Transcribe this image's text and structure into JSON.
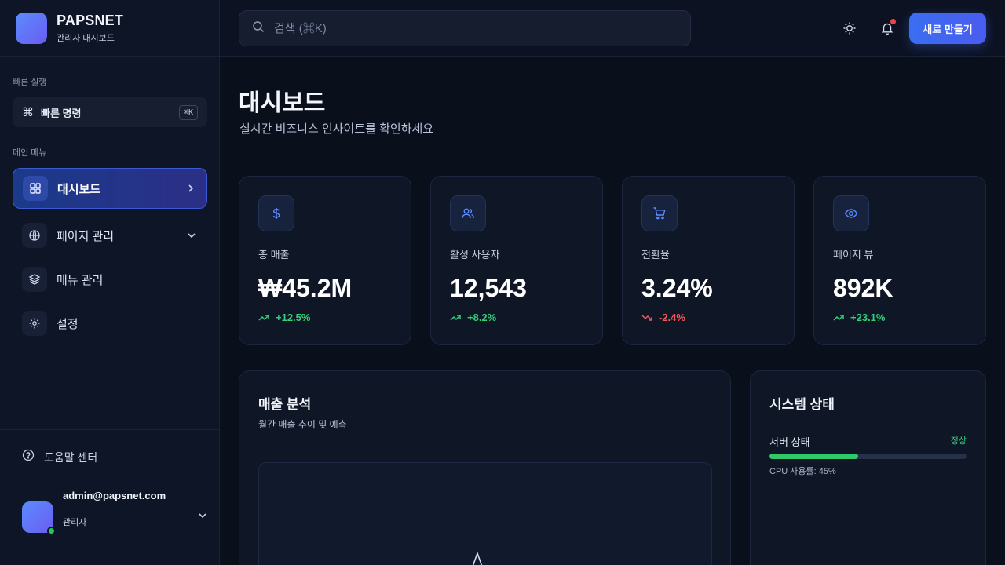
{
  "brand": {
    "name": "PAPSNET",
    "subtitle": "관리자 대시보드"
  },
  "sidebar": {
    "quick_section": "빠른 실행",
    "quick_command": {
      "label": "빠른 명령",
      "shortcut": "⌘K",
      "icon": "command-icon"
    },
    "main_section": "메인 메뉴",
    "items": [
      {
        "label": "대시보드",
        "icon": "grid-icon",
        "active": true
      },
      {
        "label": "페이지 관리",
        "icon": "globe-icon"
      },
      {
        "label": "메뉴 관리",
        "icon": "layers-icon"
      },
      {
        "label": "설정",
        "icon": "gear-icon"
      }
    ],
    "help": "도움말 센터",
    "user": {
      "email": "admin@papsnet.com",
      "role": "관리자"
    }
  },
  "header": {
    "search_placeholder": "검색 (⌘K)",
    "create_button": "새로 만들기"
  },
  "page": {
    "title": "대시보드",
    "subtitle": "실시간 비즈니스 인사이트를 확인하세요"
  },
  "stats": [
    {
      "label": "총 매출",
      "value": "₩45.2M",
      "change": "+12.5%",
      "trend": "up",
      "icon": "dollar-icon"
    },
    {
      "label": "활성 사용자",
      "value": "12,543",
      "change": "+8.2%",
      "trend": "up",
      "icon": "users-icon"
    },
    {
      "label": "전환율",
      "value": "3.24%",
      "change": "-2.4%",
      "trend": "down",
      "icon": "cart-icon"
    },
    {
      "label": "페이지 뷰",
      "value": "892K",
      "change": "+23.1%",
      "trend": "up",
      "icon": "eye-icon"
    }
  ],
  "revenue_panel": {
    "title": "매출 분석",
    "subtitle": "월간 매출 추이 및 예측"
  },
  "system_panel": {
    "title": "시스템 상태",
    "server_label": "서버 상태",
    "server_status": "정상",
    "cpu_note": "CPU 사용률: 45%",
    "cpu_usage": 0.45
  },
  "colors": {
    "accent": "#3b6df0",
    "up": "#34d07a",
    "down": "#ef5a5a"
  }
}
